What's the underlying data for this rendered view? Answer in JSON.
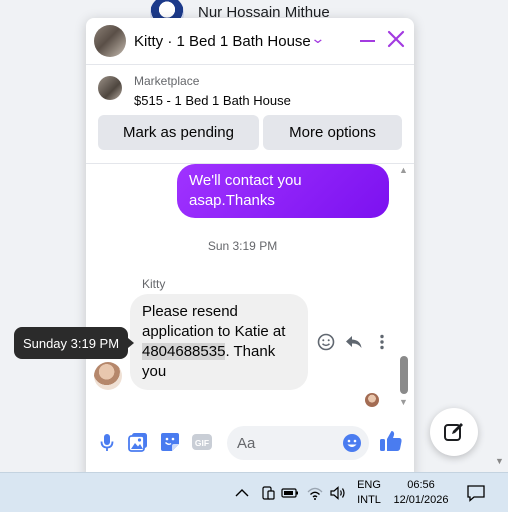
{
  "background": {
    "contact_name": "Nur Hossain Mithue"
  },
  "chat": {
    "title": "Kitty · 1 Bed 1 Bath House",
    "accent_color": "#a33be0",
    "icons": [
      "chevron-down-icon",
      "minimize-icon",
      "close-icon"
    ],
    "marketplace": {
      "label": "Marketplace",
      "listing": "$515 - 1 Bed 1 Bath House",
      "buttons": [
        "Mark as pending",
        "More options"
      ]
    },
    "messages": {
      "outgoing": {
        "text": "We'll contact you asap.Thanks"
      },
      "timestamp": "Sun 3:19 PM",
      "incoming": {
        "sender": "Kitty",
        "text_before": "Please resend application to Katie at ",
        "phone": "4804688535",
        "text_after": ". Thank you"
      },
      "message_actions": [
        "smile-icon",
        "reply-icon",
        "more-options-icon"
      ]
    },
    "tooltip": "Sunday 3:19 PM",
    "composer": {
      "placeholder": "Aa",
      "icons": [
        "microphone-icon",
        "photo-icon",
        "sticker-icon",
        "gif-icon",
        "emoji-icon",
        "thumbs-up-icon"
      ],
      "gif_label": "GIF"
    }
  },
  "new_message_button": {
    "icon": "compose-icon"
  },
  "taskbar": {
    "lang_primary": "ENG",
    "lang_secondary": "INTL",
    "time": "06:56",
    "date": "12/01/2026",
    "icons": [
      "chevron-up-icon",
      "phone-link-icon",
      "battery-icon",
      "wifi-icon",
      "volume-icon",
      "notification-icon"
    ]
  }
}
